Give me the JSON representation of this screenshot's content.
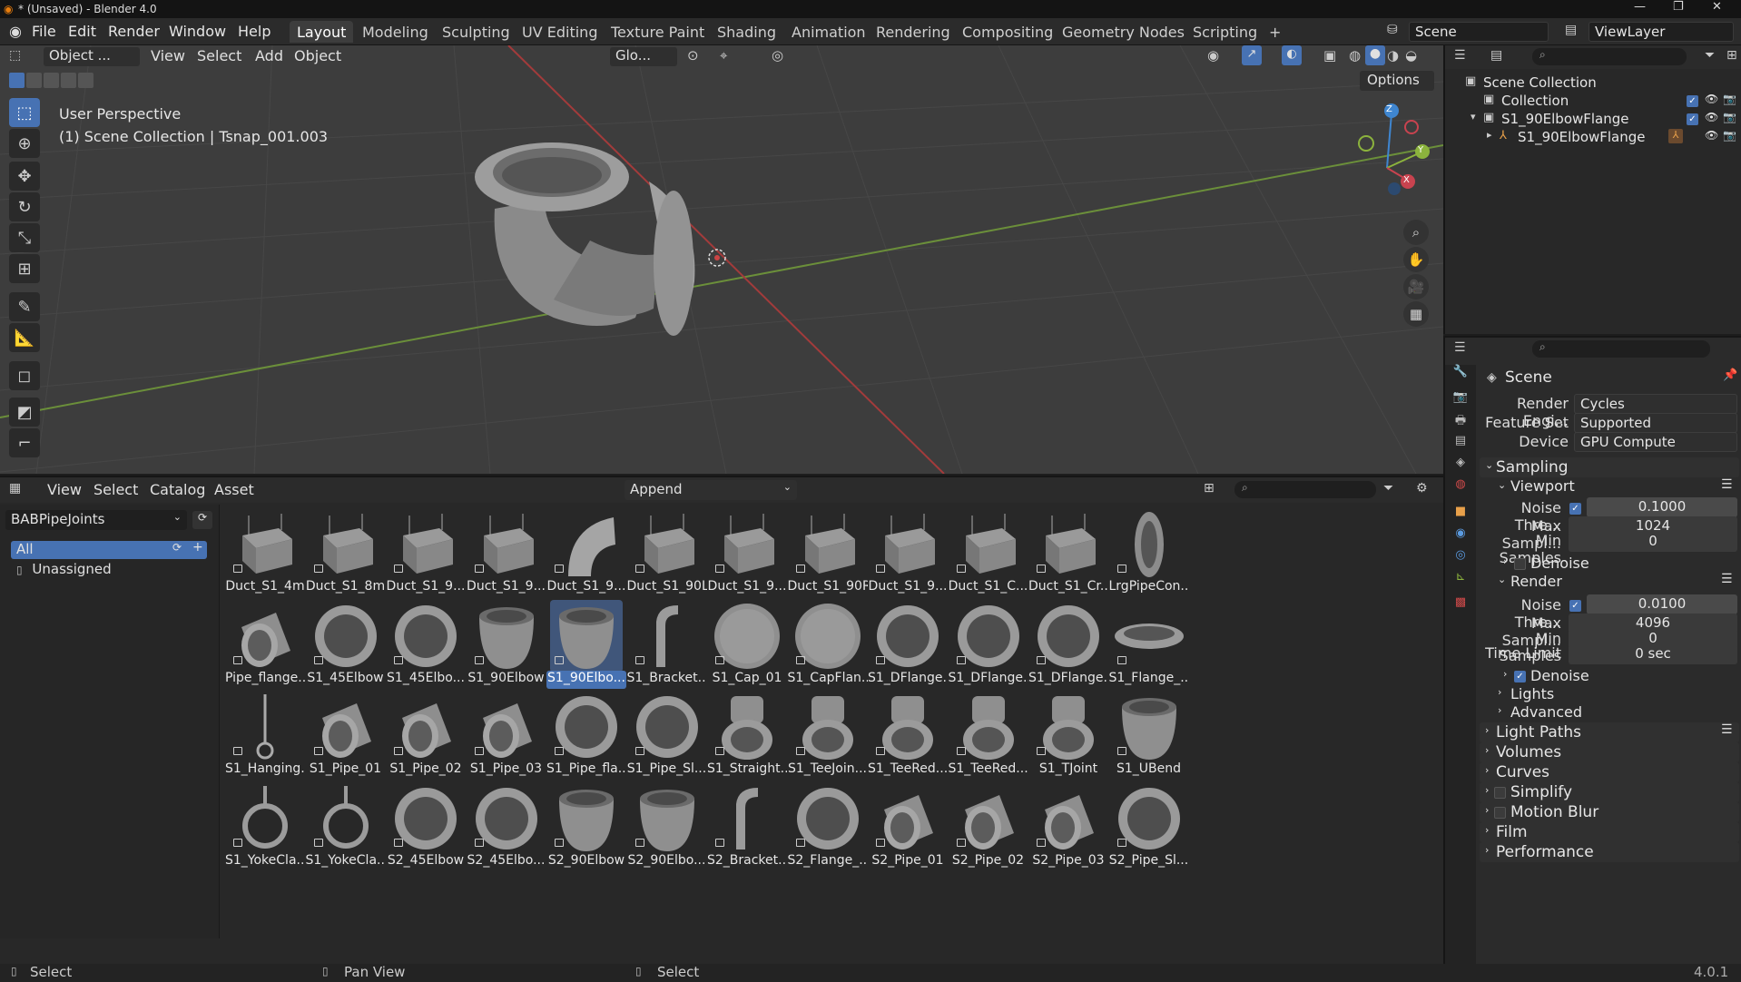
{
  "window": {
    "title": "* (Unsaved) - Blender 4.0",
    "version": "4.0.1"
  },
  "menus": [
    "File",
    "Edit",
    "Render",
    "Window",
    "Help"
  ],
  "workspaces": [
    "Layout",
    "Modeling",
    "Sculpting",
    "UV Editing",
    "Texture Paint",
    "Shading",
    "Animation",
    "Rendering",
    "Compositing",
    "Geometry Nodes",
    "Scripting"
  ],
  "active_workspace": "Layout",
  "scene_selector": "Scene",
  "viewlayer_selector": "ViewLayer",
  "viewport": {
    "mode": "Object ...",
    "menus": [
      "View",
      "Select",
      "Add",
      "Object"
    ],
    "orientation": "Glo...",
    "options_label": "Options",
    "perspective_text": "User Perspective",
    "collection_text": "(1) Scene Collection | Tsnap_001.003",
    "axes": {
      "x": "X",
      "y": "Y",
      "z": "Z"
    }
  },
  "outliner": {
    "items": [
      {
        "label": "Scene Collection"
      },
      {
        "label": "Collection"
      },
      {
        "label": "S1_90ElbowFlange"
      },
      {
        "label": "S1_90ElbowFlange"
      }
    ]
  },
  "properties": {
    "header": "Scene",
    "render_engine_label": "Render Engi...",
    "render_engine_value": "Cycles",
    "feature_set_label": "Feature Set",
    "feature_set_value": "Supported",
    "device_label": "Device",
    "device_value": "GPU Compute",
    "sampling": "Sampling",
    "viewport": "Viewport",
    "vp_noise_label": "Noise Thre...",
    "vp_noise_value": "0.1000",
    "vp_max_label": "Max Sampl...",
    "vp_max_value": "1024",
    "vp_min_label": "Min Samples",
    "vp_min_value": "0",
    "denoise": "Denoise",
    "render": "Render",
    "r_noise_label": "Noise Thre...",
    "r_noise_value": "0.0100",
    "r_max_label": "Max Sampl...",
    "r_max_value": "4096",
    "r_min_label": "Min Samples",
    "r_min_value": "0",
    "r_time_label": "Time Limit",
    "r_time_value": "0 sec",
    "r_denoise": "Denoise",
    "lights": "Lights",
    "advanced": "Advanced",
    "light_paths": "Light Paths",
    "volumes": "Volumes",
    "curves": "Curves",
    "simplify": "Simplify",
    "motion_blur": "Motion Blur",
    "film": "Film",
    "performance": "Performance"
  },
  "asset_browser": {
    "menus": [
      "View",
      "Select",
      "Catalog",
      "Asset"
    ],
    "import_method": "Append",
    "library": "BABPipeJoints",
    "catalogs": [
      "All",
      "Unassigned"
    ],
    "assets": [
      {
        "name": "Duct_S1_4m",
        "shape": "duct"
      },
      {
        "name": "Duct_S1_8m",
        "shape": "duct"
      },
      {
        "name": "Duct_S1_9...",
        "shape": "duct"
      },
      {
        "name": "Duct_S1_9...",
        "shape": "duct"
      },
      {
        "name": "Duct_S1_9...",
        "shape": "curve"
      },
      {
        "name": "Duct_S1_90L",
        "shape": "duct"
      },
      {
        "name": "Duct_S1_9...",
        "shape": "duct"
      },
      {
        "name": "Duct_S1_90R",
        "shape": "duct"
      },
      {
        "name": "Duct_S1_9...",
        "shape": "duct"
      },
      {
        "name": "Duct_S1_C...",
        "shape": "duct"
      },
      {
        "name": "Duct_S1_Cr...",
        "shape": "duct"
      },
      {
        "name": "LrgPipeCon...",
        "shape": "ringside"
      },
      {
        "name": "Pipe_flange...",
        "shape": "pipe"
      },
      {
        "name": "S1_45Elbow",
        "shape": "ring"
      },
      {
        "name": "S1_45Elbo...",
        "shape": "ring"
      },
      {
        "name": "S1_90Elbow",
        "shape": "cup"
      },
      {
        "name": "S1_90Elbo...",
        "shape": "cup",
        "selected": true
      },
      {
        "name": "S1_Bracket...",
        "shape": "bracket"
      },
      {
        "name": "S1_Cap_01",
        "shape": "disc"
      },
      {
        "name": "S1_CapFlan...",
        "shape": "disc"
      },
      {
        "name": "S1_DFlange...",
        "shape": "ring"
      },
      {
        "name": "S1_DFlange...",
        "shape": "ring"
      },
      {
        "name": "S1_DFlange...",
        "shape": "ring"
      },
      {
        "name": "S1_Flange_...",
        "shape": "flat"
      },
      {
        "name": "S1_Hanging...",
        "shape": "hanger"
      },
      {
        "name": "S1_Pipe_01",
        "shape": "pipe"
      },
      {
        "name": "S1_Pipe_02",
        "shape": "pipe"
      },
      {
        "name": "S1_Pipe_03",
        "shape": "pipe"
      },
      {
        "name": "S1_Pipe_fla...",
        "shape": "ring"
      },
      {
        "name": "S1_Pipe_Sl...",
        "shape": "ring"
      },
      {
        "name": "S1_Straight...",
        "shape": "tee"
      },
      {
        "name": "S1_TeeJoin...",
        "shape": "tee"
      },
      {
        "name": "S1_TeeRed...",
        "shape": "tee"
      },
      {
        "name": "S1_TeeRed...",
        "shape": "tee"
      },
      {
        "name": "S1_TJoint",
        "shape": "tee"
      },
      {
        "name": "S1_UBend",
        "shape": "cup"
      },
      {
        "name": "S1_YokeCla...",
        "shape": "yoke"
      },
      {
        "name": "S1_YokeCla...",
        "shape": "yoke"
      },
      {
        "name": "S2_45Elbow",
        "shape": "ring"
      },
      {
        "name": "S2_45Elbo...",
        "shape": "ring"
      },
      {
        "name": "S2_90Elbow",
        "shape": "cup"
      },
      {
        "name": "S2_90Elbo...",
        "shape": "cup"
      },
      {
        "name": "S2_Bracket...",
        "shape": "bracket"
      },
      {
        "name": "S2_Flange_...",
        "shape": "ring"
      },
      {
        "name": "S2_Pipe_01",
        "shape": "pipe"
      },
      {
        "name": "S2_Pipe_02",
        "shape": "pipe"
      },
      {
        "name": "S2_Pipe_03",
        "shape": "pipe"
      },
      {
        "name": "S2_Pipe_Sl...",
        "shape": "ring"
      }
    ]
  },
  "statusbar": {
    "left": "Select",
    "middle": "Pan View",
    "right": "Select"
  },
  "colors": {
    "accent": "#4772b3",
    "viewport": "#3d3d3d",
    "x_axis": "#c8434f",
    "y_axis": "#8cb33d",
    "z_axis": "#3f86d0"
  }
}
